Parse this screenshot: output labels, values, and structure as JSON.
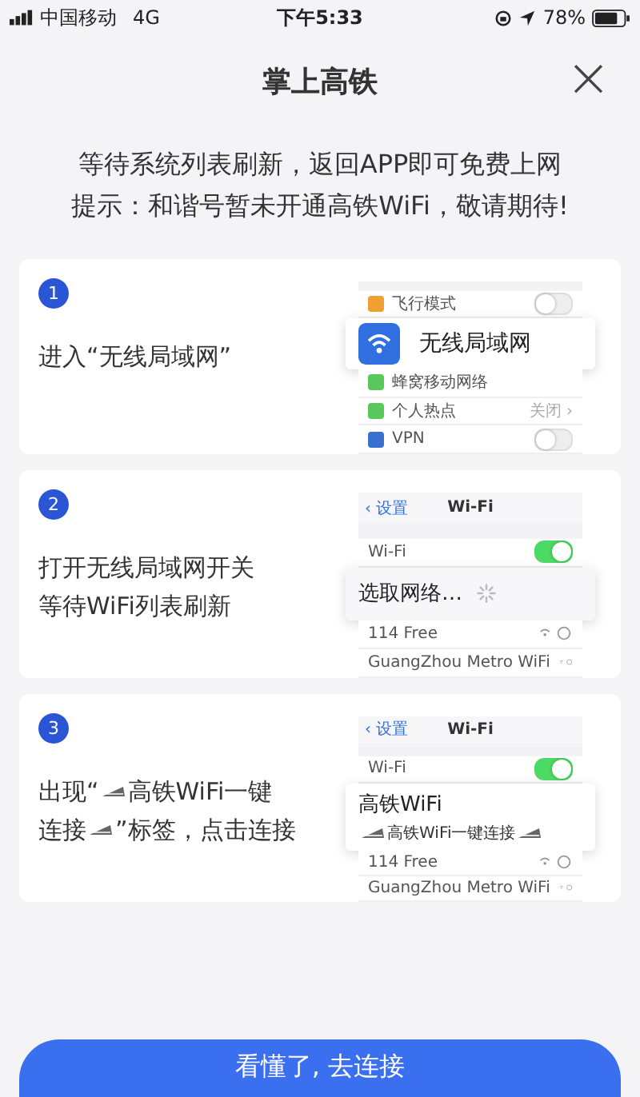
{
  "status_bar": {
    "carrier": "中国移动",
    "network": "4G",
    "time": "下午5:33",
    "battery": "78%"
  },
  "header": {
    "title": "掌上高铁",
    "close": "×"
  },
  "intro": [
    "等待系统列表刷新，返回APP即可免费上网",
    "提示：和谐号暂未开通高铁WiFi，敬请期待!"
  ],
  "steps": [
    {
      "number": "1",
      "lines": [
        [
          {
            "kind": "text",
            "text": "进入“无线局域网”"
          }
        ]
      ],
      "illustration": {
        "kind": "settings",
        "rows_before": [
          {
            "label": "飞行模式",
            "color": "#f0a030",
            "toggle": false
          }
        ],
        "popup": {
          "kind": "wlan",
          "title": "无线局域网"
        },
        "rows_after": [
          {
            "label": "蜂窝移动网络",
            "color": "#5ac85a"
          },
          {
            "label": "个人热点",
            "color": "#5ac85a",
            "detail": "关闭 ›"
          },
          {
            "label": "VPN",
            "color": "#3a6fd0",
            "toggle": false
          }
        ]
      }
    },
    {
      "number": "2",
      "lines": [
        [
          {
            "kind": "text",
            "text": "打开无线局域网开关"
          }
        ],
        [
          {
            "kind": "text",
            "text": "等待WiFi列表刷新"
          }
        ]
      ],
      "illustration": {
        "kind": "wifi",
        "back": "‹ 设置",
        "nav_title": "Wi-Fi",
        "switch_label": "Wi-Fi",
        "switch_on": true,
        "popup": {
          "kind": "searching",
          "title": "选取网络…"
        },
        "networks": [
          "114 Free",
          "GuangZhou Metro WiFi"
        ]
      }
    },
    {
      "number": "3",
      "lines": [
        [
          {
            "kind": "text",
            "text": "出现“"
          },
          {
            "kind": "train"
          },
          {
            "kind": "text",
            "text": "高铁WiFi一键"
          }
        ],
        [
          {
            "kind": "text",
            "text": "连接"
          },
          {
            "kind": "train"
          },
          {
            "kind": "text",
            "text": "”标签，点击连接"
          }
        ]
      ],
      "illustration": {
        "kind": "wifi",
        "back": "‹ 设置",
        "nav_title": "Wi-Fi",
        "switch_label": "Wi-Fi",
        "switch_on": true,
        "popup": {
          "kind": "network",
          "title": "高铁WiFi",
          "subtitle": "高铁WiFi一键连接"
        },
        "networks": [
          "114 Free",
          "GuangZhou Metro WiFi"
        ]
      }
    }
  ],
  "button": "看懂了, 去连接"
}
